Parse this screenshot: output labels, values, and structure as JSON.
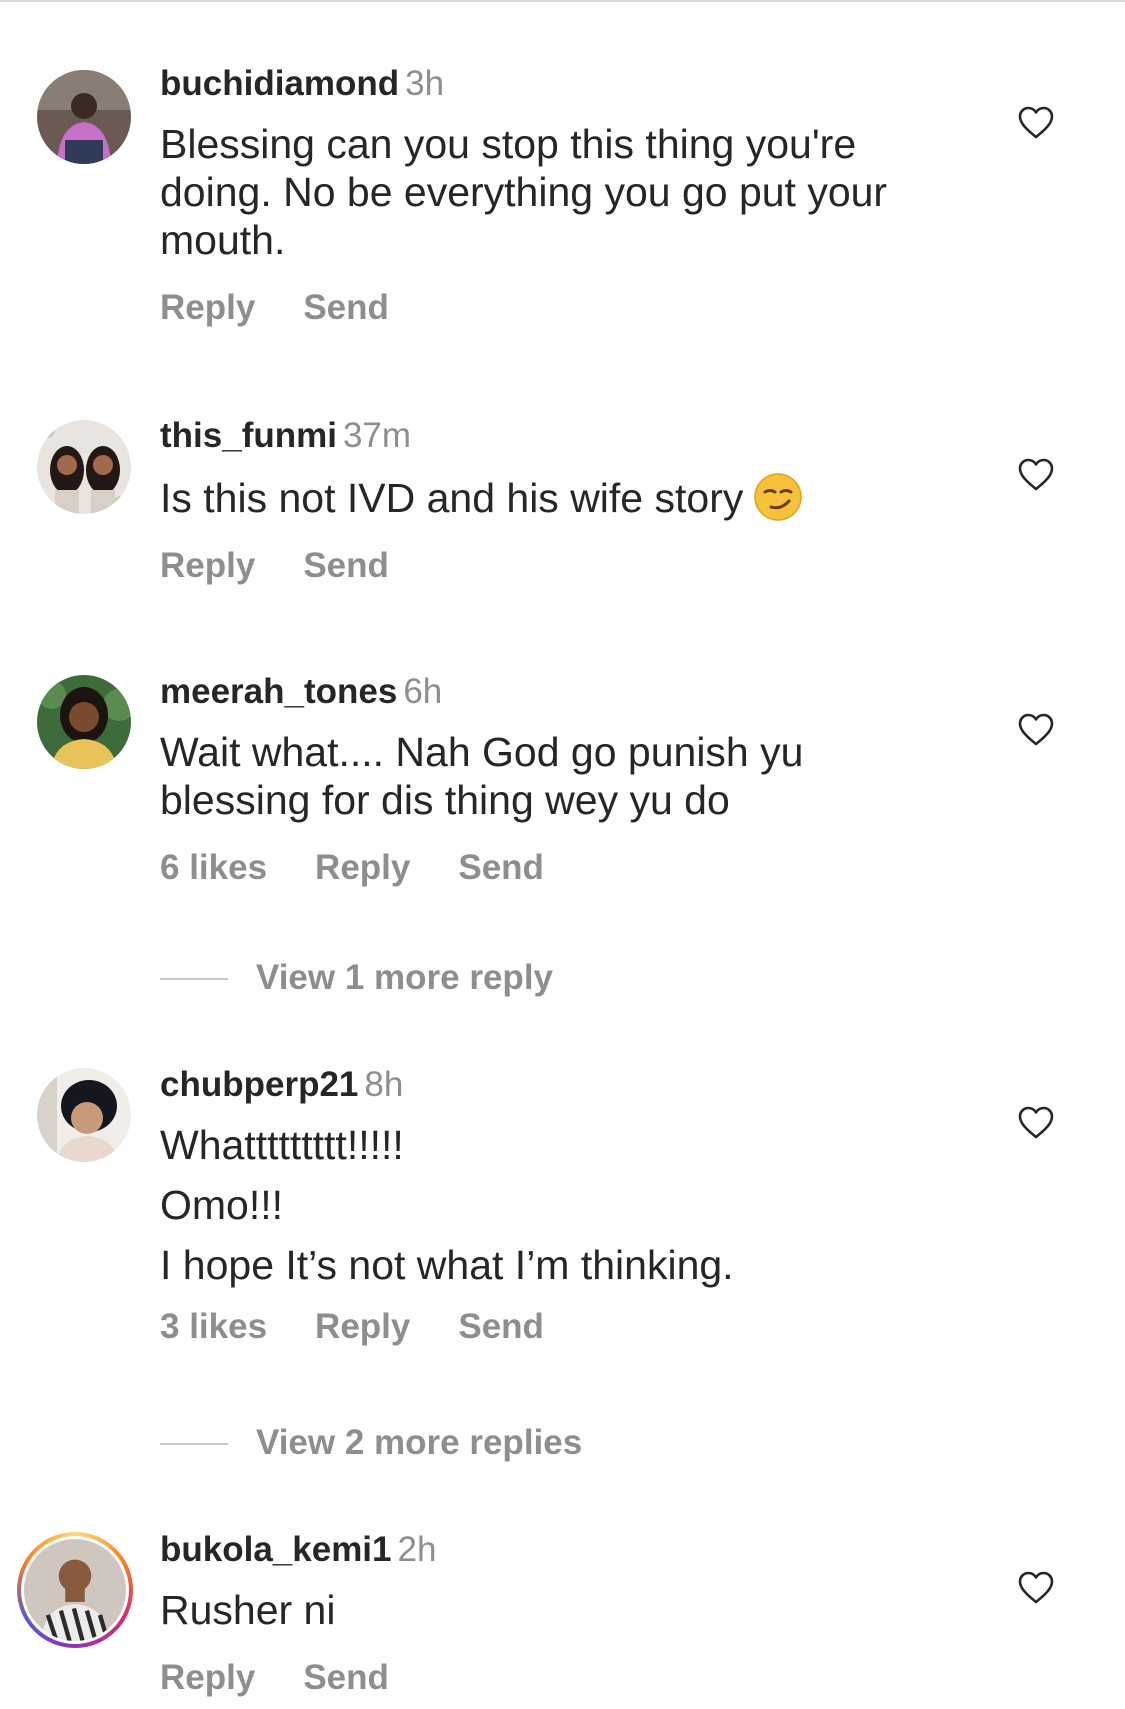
{
  "comments": [
    {
      "username": "buchidiamond",
      "time": "3h",
      "lines": [
        "Blessing can you stop this thing you're",
        "doing. No be everything you go put your",
        "mouth."
      ],
      "likes": "",
      "reply_label": "Reply",
      "send_label": "Send"
    },
    {
      "username": "this_funmi",
      "time": "37m",
      "lines": [
        "Is this not IVD and his wife story"
      ],
      "emoji": "smirk-emoji",
      "likes": "",
      "reply_label": "Reply",
      "send_label": "Send"
    },
    {
      "username": "meerah_tones",
      "time": "6h",
      "lines": [
        "Wait what.... Nah God go punish yu",
        "blessing for dis thing wey yu do"
      ],
      "likes": "6 likes",
      "reply_label": "Reply",
      "send_label": "Send",
      "view_more": "View 1 more reply"
    },
    {
      "username": "chubperp21",
      "time": "8h",
      "lines": [
        "Whattttttttt!!!!!",
        "Omo!!!",
        "I hope It’s not what I’m thinking."
      ],
      "likes": "3 likes",
      "reply_label": "Reply",
      "send_label": "Send",
      "view_more": "View 2 more replies"
    },
    {
      "username": "bukola_kemi1",
      "time": "2h",
      "lines": [
        "Rusher ni"
      ],
      "likes": "",
      "reply_label": "Reply",
      "send_label": "Send",
      "story_ring": true
    }
  ],
  "icons": {
    "like": "heart-outline-icon"
  },
  "colors": {
    "primary_text": "#262626",
    "secondary_text": "#8e8e8e",
    "divider": "#c7c7c7",
    "story_ring_start": "#feda75",
    "story_ring_end": "#d62976"
  }
}
